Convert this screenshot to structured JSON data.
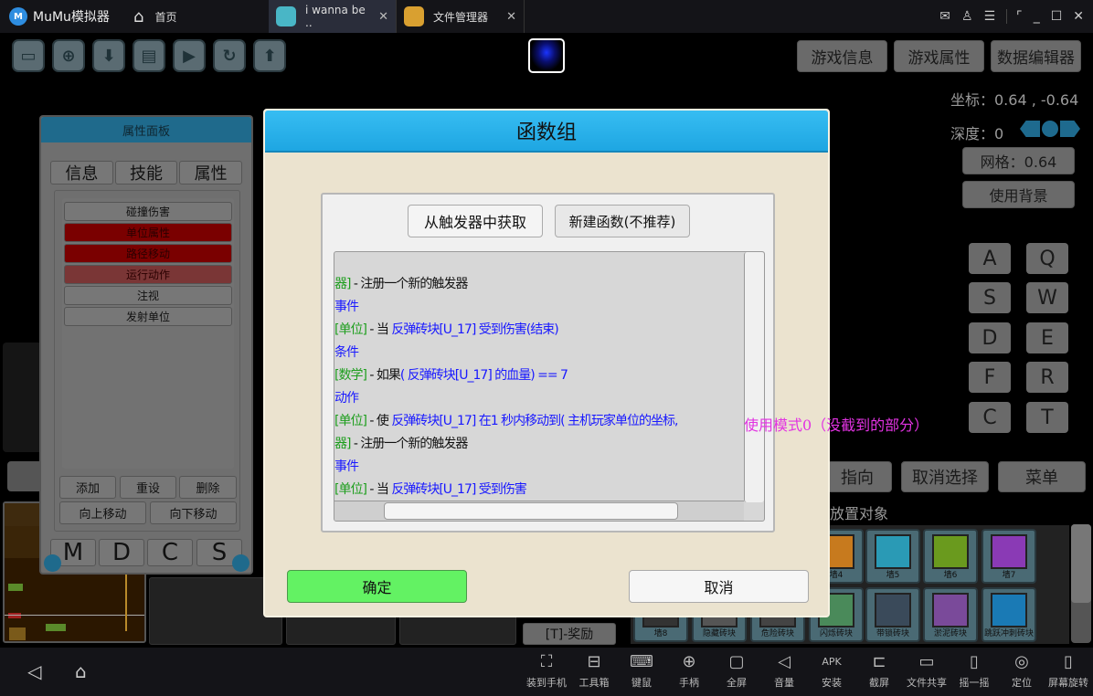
{
  "titlebar": {
    "app_name": "MuMu模拟器",
    "home_label": "首页",
    "tabs": [
      {
        "label": "i wanna be ..",
        "active": true,
        "icon": "game-icon"
      },
      {
        "label": "文件管理器",
        "active": false,
        "icon": "folder-icon"
      }
    ],
    "window_controls": [
      "mail-icon",
      "user-icon",
      "menu-icon",
      "screenshot-icon",
      "minimize-icon",
      "maximize-icon",
      "close-icon"
    ]
  },
  "toolbar": {
    "icons": [
      "folder-open-icon",
      "new-file-icon",
      "download-icon",
      "save-icon",
      "play-icon",
      "refresh-icon",
      "upload-icon"
    ]
  },
  "top_buttons": {
    "game_info": "游戏信息",
    "game_props": "游戏属性",
    "data_editor": "数据编辑器"
  },
  "status": {
    "coords": "坐标：0.64 , -0.64",
    "depth": "深度：0",
    "grid": "网格：0.64",
    "use_bg": "使用背景"
  },
  "keys": [
    "A",
    "Q",
    "S",
    "W",
    "D",
    "E",
    "F",
    "R",
    "C",
    "T"
  ],
  "attr_panel": {
    "title": "属性面板",
    "tabs": [
      "信息",
      "技能",
      "属性"
    ],
    "items": [
      {
        "label": "碰撞伤害",
        "state": "normal"
      },
      {
        "label": "单位属性",
        "state": "selected"
      },
      {
        "label": "路径移动",
        "state": "selected"
      },
      {
        "label": "运行动作",
        "state": "highlight"
      },
      {
        "label": "注视",
        "state": "normal"
      },
      {
        "label": "发射单位",
        "state": "normal"
      }
    ],
    "add": "添加",
    "reset": "重设",
    "delete": "删除",
    "move_up": "向上移动",
    "move_down": "向下移动",
    "modes": [
      "M",
      "D",
      "C",
      "S"
    ]
  },
  "dialog": {
    "title": "函数组",
    "from_trigger": "从触发器中获取",
    "new_function": "新建函数(不推荐)",
    "code_lines": [
      {
        "tag": "器]",
        "tag_color": "green",
        "text": " - 注册一个新的触发器",
        "rest": ""
      },
      {
        "tag": "",
        "tag_color": "",
        "text": "",
        "rest": "事件"
      },
      {
        "tag": "[单位]",
        "tag_color": "green",
        "text": " - 当 ",
        "rest": "反弹砖块[U_17]  受到伤害(结束)"
      },
      {
        "tag": "",
        "tag_color": "",
        "text": "",
        "rest": "条件"
      },
      {
        "tag": "[数学]",
        "tag_color": "green",
        "text": " - 如果",
        "rest": "( 反弹砖块[U_17] 的血量)  ==  7"
      },
      {
        "tag": "",
        "tag_color": "",
        "text": "",
        "rest": "动作"
      },
      {
        "tag": "[单位]",
        "tag_color": "green",
        "text": " - 使 ",
        "rest": "反弹砖块[U_17] 在1 秒内移动到( 主机玩家单位的坐标,"
      },
      {
        "tag": "器]",
        "tag_color": "green",
        "text": " - 注册一个新的触发器",
        "rest": ""
      },
      {
        "tag": "",
        "tag_color": "",
        "text": "",
        "rest": "事件"
      },
      {
        "tag": "[单位]",
        "tag_color": "green",
        "text": " - 当 ",
        "rest": "反弹砖块[U_17]  受到伤害"
      }
    ],
    "ok": "确定",
    "cancel": "取消"
  },
  "annotation": "使用模式0（没截到的部分）",
  "right_panel": {
    "point_dir": "指向",
    "deselect": "取消选择",
    "menu": "菜单",
    "place_label": "放置对象",
    "tiles_row1": [
      {
        "label": "墙4",
        "color": "#c77a1e"
      },
      {
        "label": "墙5",
        "color": "#2a9ab5"
      },
      {
        "label": "墙6",
        "color": "#6a9a1e"
      },
      {
        "label": "墙7",
        "color": "#8a3ab5"
      }
    ],
    "tiles_row2": [
      {
        "label": "墙8",
        "color": "#333"
      },
      {
        "label": "隐藏砖块",
        "color": "#555"
      },
      {
        "label": "危险砖块",
        "color": "#444"
      },
      {
        "label": "闪烁砖块",
        "color": "#4a8a5a"
      },
      {
        "label": "带锁砖块",
        "color": "#3a4a5a"
      },
      {
        "label": "淤泥砖块",
        "color": "#7a4a9a"
      },
      {
        "label": "跳跃冲刺砖块",
        "color": "#1a7ab5"
      }
    ],
    "reward": "[T]-奖励"
  },
  "bottom_bar": {
    "items": [
      {
        "label": "装到手机",
        "icon": "install-to-phone-icon",
        "glyph": "⛶"
      },
      {
        "label": "工具箱",
        "icon": "toolbox-icon",
        "glyph": "⊟"
      },
      {
        "label": "键鼠",
        "icon": "keyboard-icon",
        "glyph": "⌨"
      },
      {
        "label": "手柄",
        "icon": "gamepad-icon",
        "glyph": "⊕"
      },
      {
        "label": "全屏",
        "icon": "fullscreen-icon",
        "glyph": "▢"
      },
      {
        "label": "音量",
        "icon": "volume-icon",
        "glyph": "◁"
      },
      {
        "label": "安装",
        "icon": "apk-icon",
        "glyph": "APK"
      },
      {
        "label": "截屏",
        "icon": "crop-icon",
        "glyph": "⊏"
      },
      {
        "label": "文件共享",
        "icon": "folder-share-icon",
        "glyph": "▭"
      },
      {
        "label": "摇一摇",
        "icon": "shake-icon",
        "glyph": "▯"
      },
      {
        "label": "定位",
        "icon": "location-icon",
        "glyph": "◎"
      },
      {
        "label": "屏幕旋转",
        "icon": "rotate-screen-icon",
        "glyph": "▯"
      }
    ]
  }
}
